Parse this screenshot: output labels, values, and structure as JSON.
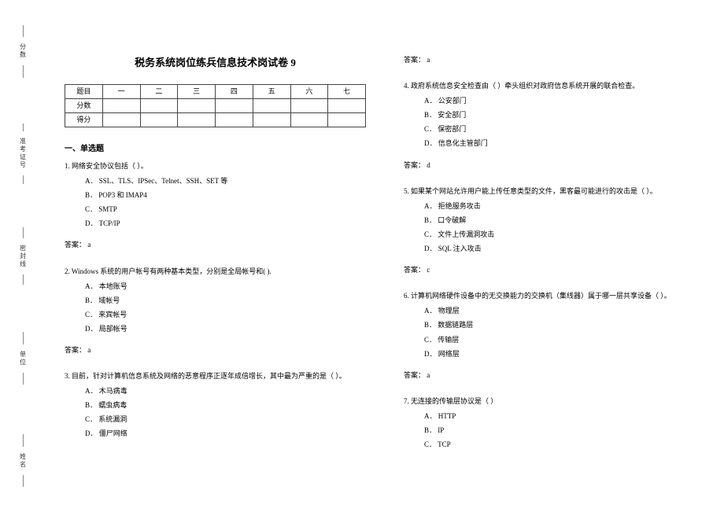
{
  "binding": {
    "labels": [
      "分数",
      "准考证号",
      "密封线",
      "单位",
      "姓名"
    ]
  },
  "title": "税务系统岗位练兵信息技术岗试卷 9",
  "score_table": {
    "row_labels": [
      "题目",
      "分数",
      "得分"
    ],
    "columns": [
      "一",
      "二",
      "三",
      "四",
      "五",
      "六",
      "七"
    ]
  },
  "section1": {
    "heading": "一、单选题"
  },
  "q1": {
    "stem": "1.    网络安全协议包括（  ）。",
    "options": {
      "A": "A．   SSL、TLS、IPSec、Telnet、SSH、SET 等",
      "B": "B．   POP3 和 IMAP4",
      "C": "C．   SMTP",
      "D": "D．   TCP/IP"
    },
    "answer": "答案：  a"
  },
  "q2": {
    "stem": "2.    Windows  系统的用户帐号有两种基本类型，分别是全局帐号和(  ).",
    "options": {
      "A": "A．   本地账号",
      "B": "B．   域帐号",
      "C": "C．   来宾帐号",
      "D": "D．   局部帐号"
    },
    "answer": "答案：  a"
  },
  "q3": {
    "stem": "3.    目前，针对计算机信息系统及网络的恶意程序正逐年成倍增长，其中最为严重的是（  ）。",
    "options": {
      "A": "A．   木马病毒",
      "B": "B．   蠕虫病毒",
      "C": "C．   系统漏洞",
      "D": "D．   僵尸网络"
    },
    "answer": "答案：  a"
  },
  "q4": {
    "stem": "4.    政府系统信息安全检查由（  ）牵头组织对政府信息系统开展的联合检查。",
    "options": {
      "A": "A．   公安部门",
      "B": "B．   安全部门",
      "C": "C．   保密部门",
      "D": "D．   信息化主管部门"
    },
    "answer": "答案：  d"
  },
  "q5": {
    "stem": "5.    如果某个网站允许用户能上传任意类型的文件，黑客最可能进行的攻击是（  ）。",
    "options": {
      "A": "A．   拒绝服务攻击",
      "B": "B．   口令破解",
      "C": "C．   文件上传漏洞攻击",
      "D": "D．   SQL 注入攻击"
    },
    "answer": "答案：  c"
  },
  "q6": {
    "stem": "6.    计算机网络硬件设备中的无交换能力的交换机（集线器）属于哪一层共享设备（  ）。",
    "options": {
      "A": "A．   物理层",
      "B": "B．   数据链路层",
      "C": "C．   传输层",
      "D": "D．   网络层"
    },
    "answer": "答案：  a"
  },
  "q7": {
    "stem": "7.    无连接的传输层协议是（       ）",
    "options": {
      "A": "A．   HTTP",
      "B": "B．   IP",
      "C": "C．   TCP"
    }
  }
}
